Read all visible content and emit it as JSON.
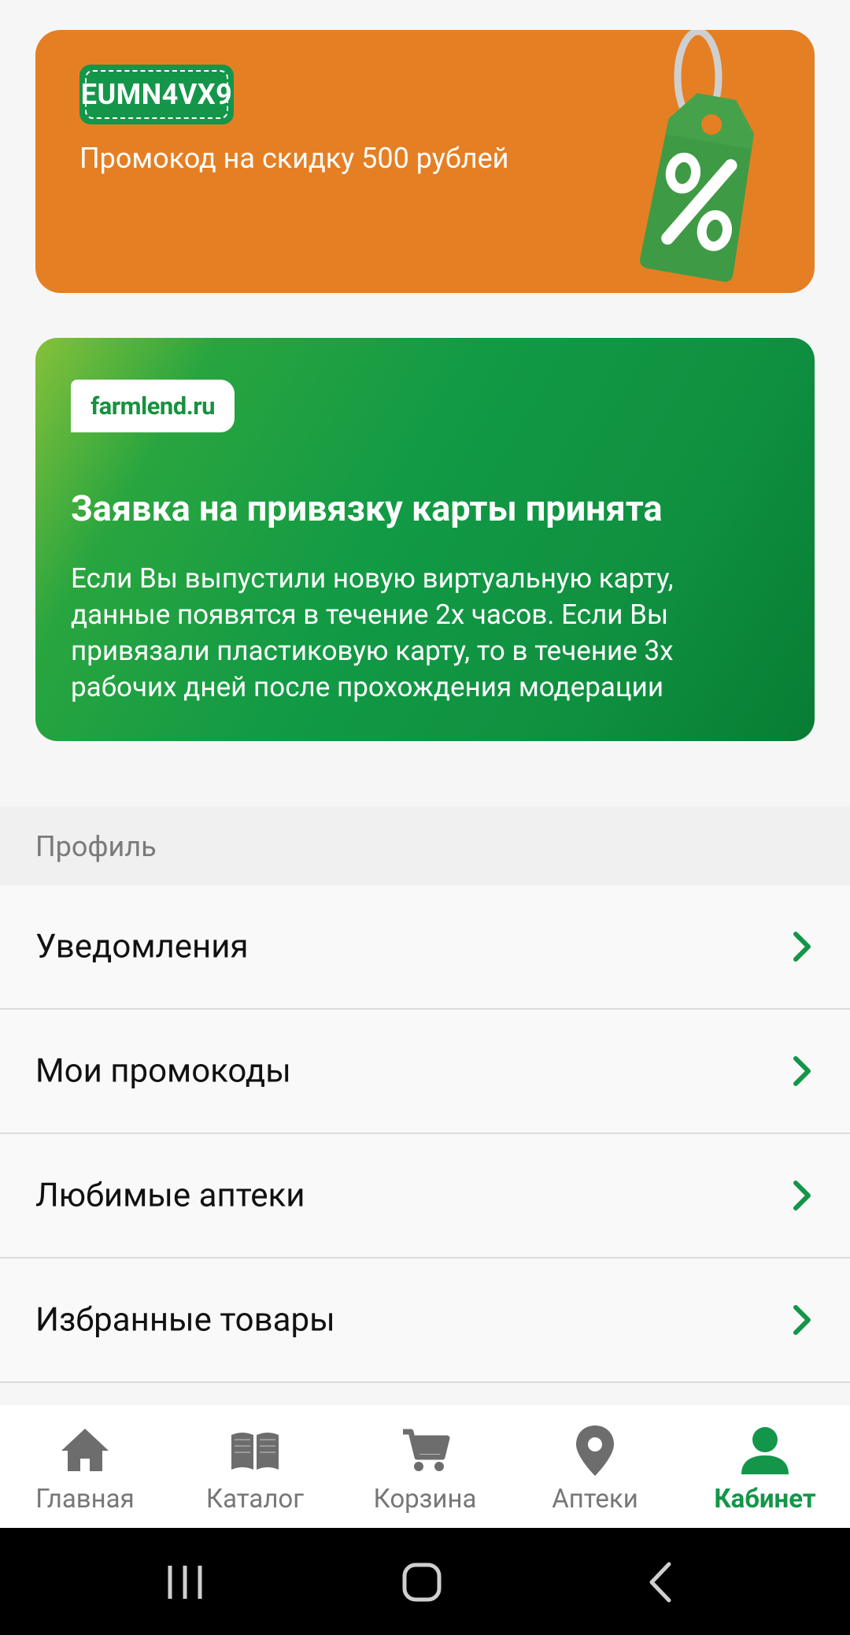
{
  "promo": {
    "code": "EUMN4VX9",
    "description": "Промокод на скидку 500 рублей",
    "icon": "percent-tag-icon"
  },
  "card_notice": {
    "logo": "farmlend.ru",
    "title": "Заявка на привязку карты принята",
    "text": "Если Вы выпустили новую виртуальную карту, данные появятся в течение 2х часов. Если Вы привязали пластиковую карту, то в течение 3х рабочих дней после прохождения модерации"
  },
  "profile": {
    "section_label": "Профиль",
    "items": [
      {
        "label": "Уведомления"
      },
      {
        "label": "Мои промокоды"
      },
      {
        "label": "Любимые аптеки"
      },
      {
        "label": "Избранные товары"
      }
    ]
  },
  "bottom_nav": {
    "items": [
      {
        "label": "Главная",
        "icon": "home-icon"
      },
      {
        "label": "Каталог",
        "icon": "book-icon"
      },
      {
        "label": "Корзина",
        "icon": "cart-icon"
      },
      {
        "label": "Аптеки",
        "icon": "location-pin-icon"
      },
      {
        "label": "Кабинет",
        "icon": "user-icon",
        "active": true
      }
    ]
  },
  "colors": {
    "accent": "#14964a",
    "promo_bg": "#e57f24",
    "inactive": "#6d6d6d"
  }
}
